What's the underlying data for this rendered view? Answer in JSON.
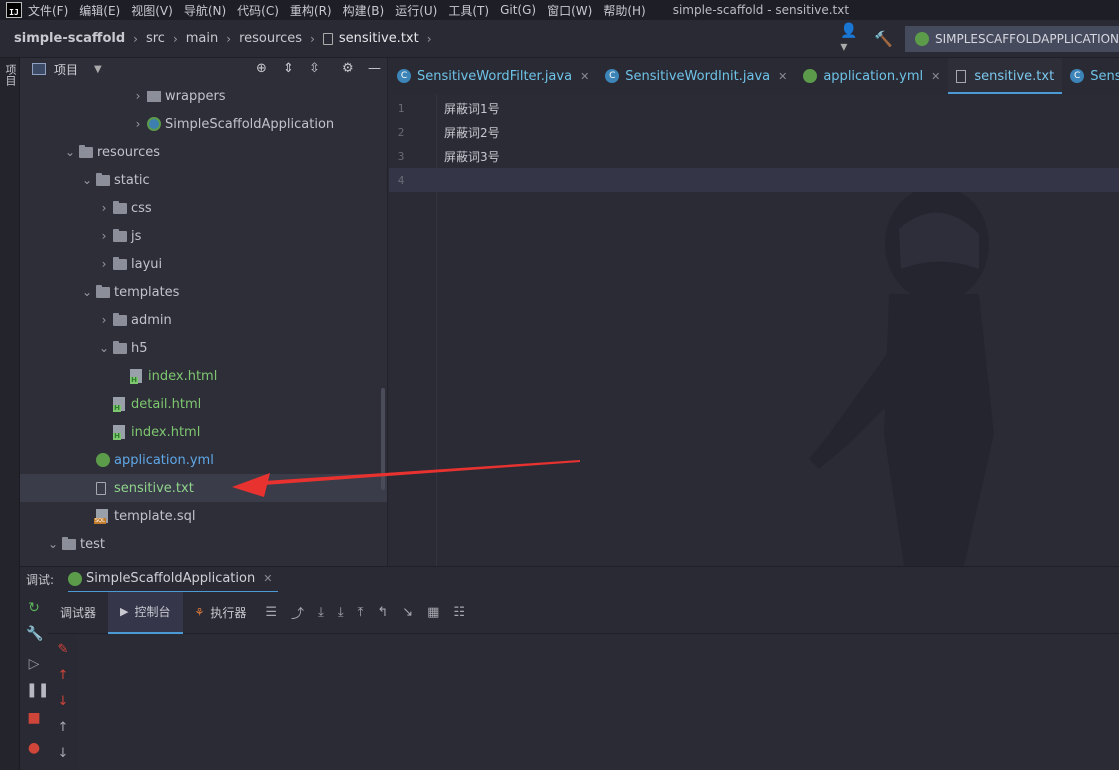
{
  "menubar": {
    "logo": "IJ",
    "items": [
      "文件(F)",
      "编辑(E)",
      "视图(V)",
      "导航(N)",
      "代码(C)",
      "重构(R)",
      "构建(B)",
      "运行(U)",
      "工具(T)",
      "Git(G)",
      "窗口(W)",
      "帮助(H)"
    ],
    "window_title": "simple-scaffold - sensitive.txt"
  },
  "breadcrumb": {
    "items": [
      "simple-scaffold",
      "src",
      "main",
      "resources",
      "sensitive.txt"
    ]
  },
  "toolbar": {
    "run_config": "SIMPLESCAFFOLDAPPLICATION"
  },
  "left_strip": {
    "project_tab": "项目"
  },
  "project_panel": {
    "title": "项目",
    "tree": [
      {
        "label": "wrappers",
        "depth": 7,
        "expanded": false,
        "kind": "package"
      },
      {
        "label": "SimpleScaffoldApplication",
        "depth": 7,
        "expanded": false,
        "kind": "app"
      },
      {
        "label": "resources",
        "depth": 3,
        "expanded": true,
        "kind": "folder"
      },
      {
        "label": "static",
        "depth": 4,
        "expanded": true,
        "kind": "folder"
      },
      {
        "label": "css",
        "depth": 5,
        "expanded": false,
        "kind": "folder"
      },
      {
        "label": "js",
        "depth": 5,
        "expanded": false,
        "kind": "folder"
      },
      {
        "label": "layui",
        "depth": 5,
        "expanded": false,
        "kind": "folder"
      },
      {
        "label": "templates",
        "depth": 4,
        "expanded": true,
        "kind": "folder"
      },
      {
        "label": "admin",
        "depth": 5,
        "expanded": false,
        "kind": "folder"
      },
      {
        "label": "h5",
        "depth": 5,
        "expanded": true,
        "kind": "folder"
      },
      {
        "label": "index.html",
        "depth": 6,
        "kind": "html"
      },
      {
        "label": "detail.html",
        "depth": 5,
        "kind": "html"
      },
      {
        "label": "index.html",
        "depth": 5,
        "kind": "html"
      },
      {
        "label": "application.yml",
        "depth": 4,
        "kind": "yml"
      },
      {
        "label": "sensitive.txt",
        "depth": 4,
        "kind": "txt",
        "selected": true
      },
      {
        "label": "template.sql",
        "depth": 4,
        "kind": "sql"
      },
      {
        "label": "test",
        "depth": 2,
        "expanded": true,
        "kind": "folder"
      }
    ]
  },
  "editor": {
    "tabs": [
      {
        "label": "SensitiveWordFilter.java",
        "icon": "class-icon",
        "active": false,
        "closable": true
      },
      {
        "label": "SensitiveWordInit.java",
        "icon": "class-icon",
        "active": false,
        "closable": true
      },
      {
        "label": "application.yml",
        "icon": "yml-icon",
        "active": false,
        "closable": true
      },
      {
        "label": "sensitive.txt",
        "icon": "txt-icon",
        "active": true,
        "closable": false
      },
      {
        "label": "SensitiveWordF",
        "icon": "class-icon",
        "active": false,
        "closable": false
      }
    ],
    "lines": [
      "屏蔽词1号",
      "屏蔽词2号",
      "屏蔽词3号",
      ""
    ],
    "line_numbers": [
      "1",
      "2",
      "3",
      "4"
    ],
    "current_line": 4
  },
  "debug": {
    "label": "调试:",
    "session": "SimpleScaffoldApplication",
    "subtabs": [
      "调试器",
      "控制台",
      "执行器"
    ],
    "active_subtab": "控制台"
  },
  "colors": {
    "accent": "#4b9ad6",
    "selection": "#3b3c4a",
    "arrow": "#e8322f"
  }
}
